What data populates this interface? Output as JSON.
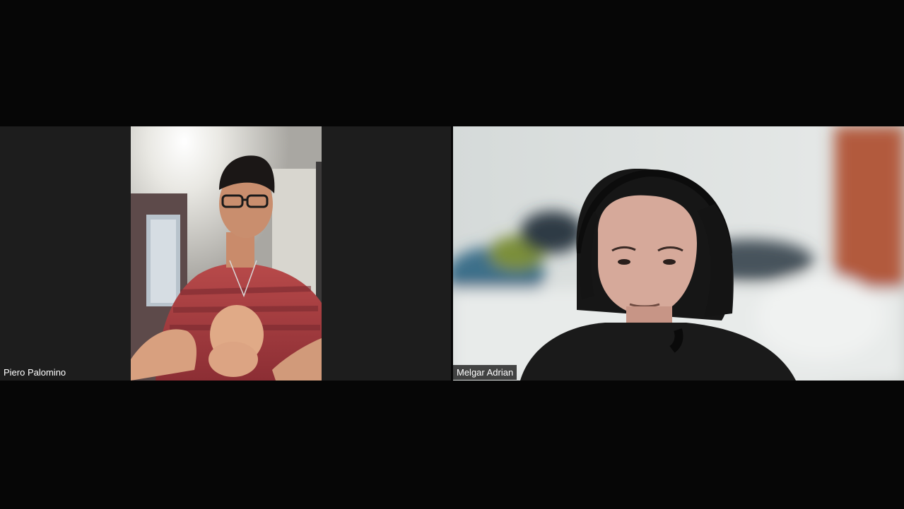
{
  "meeting": {
    "participants": [
      {
        "name": "Piero Palomino"
      },
      {
        "name": "Melgar Adrian"
      }
    ]
  },
  "colors": {
    "stage_background": "#060606",
    "tile_background": "#1d1d1d",
    "name_tag_text": "#ffffff"
  }
}
